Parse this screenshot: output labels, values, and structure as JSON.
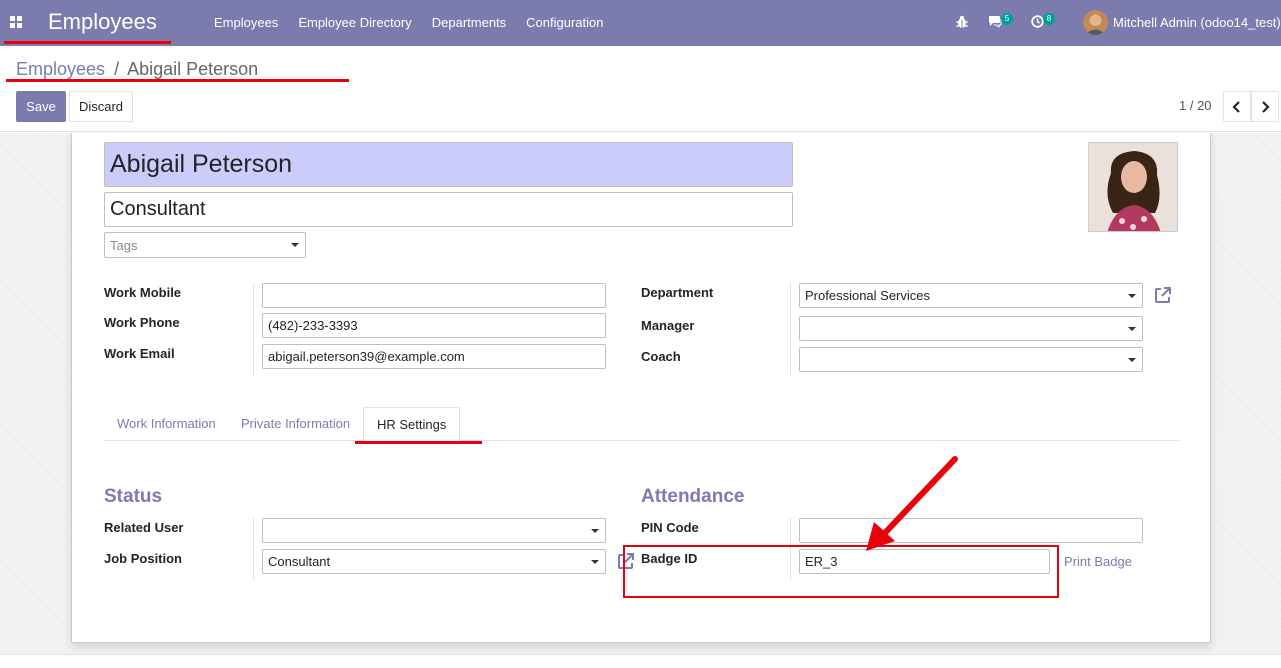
{
  "navbar": {
    "app_title": "Employees",
    "menu": [
      "Employees",
      "Employee Directory",
      "Departments",
      "Configuration"
    ],
    "messages_count": "5",
    "activities_count": "8",
    "user": "Mitchell Admin (odoo14_test)"
  },
  "breadcrumb": {
    "parent": "Employees",
    "separator": "/",
    "current": "Abigail Peterson"
  },
  "buttons": {
    "save": "Save",
    "discard": "Discard"
  },
  "pager": {
    "value": "1 / 20"
  },
  "employee": {
    "name": "Abigail Peterson",
    "job_title": "Consultant",
    "tags_placeholder": "Tags"
  },
  "contact": {
    "work_mobile_label": "Work Mobile",
    "work_mobile_value": "",
    "work_phone_label": "Work Phone",
    "work_phone_value": "(482)-233-3393",
    "work_email_label": "Work Email",
    "work_email_value": "abigail.peterson39@example.com"
  },
  "org": {
    "department_label": "Department",
    "department_value": "Professional Services",
    "manager_label": "Manager",
    "manager_value": "",
    "coach_label": "Coach",
    "coach_value": ""
  },
  "tabs": [
    {
      "label": "Work Information",
      "active": false
    },
    {
      "label": "Private Information",
      "active": false
    },
    {
      "label": "HR Settings",
      "active": true
    }
  ],
  "status": {
    "title": "Status",
    "related_user_label": "Related User",
    "related_user_value": "",
    "job_position_label": "Job Position",
    "job_position_value": "Consultant"
  },
  "attendance": {
    "title": "Attendance",
    "pin_code_label": "PIN Code",
    "pin_code_value": "",
    "badge_id_label": "Badge ID",
    "badge_id_value": "ER_3",
    "print_badge": "Print Badge"
  },
  "colors": {
    "brand": "#7c7bad",
    "name_field_bg": "#ccccfb",
    "annotation_red": "#e8000b",
    "badge_teal": "#00a09d"
  },
  "icons": [
    "apps-icon",
    "bug-icon",
    "chat-icon",
    "clock-icon",
    "chevron-left-icon",
    "chevron-right-icon",
    "caret-down-icon",
    "external-link-icon"
  ]
}
